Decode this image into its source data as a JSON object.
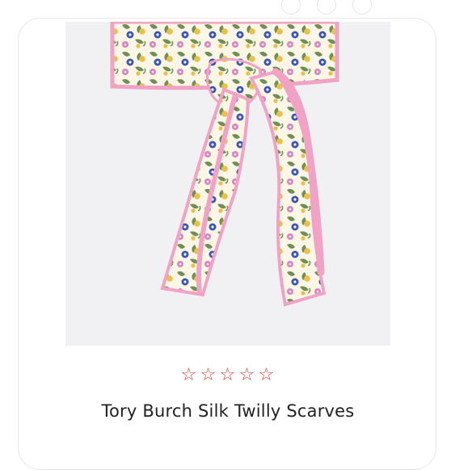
{
  "product": {
    "title": "Tory Burch Silk Twilly Scarves",
    "image_alt": "Floral silk twilly scarf tied in a bow",
    "rating": {
      "stars_filled": 0,
      "stars_total": 5,
      "star_glyph": "☆"
    }
  },
  "colors": {
    "star": "#d33b3b",
    "image_bg": "#f1f0f3",
    "scarf_pink": "#f0a3c4",
    "scarf_cream": "#fbf6e6",
    "leaf_green": "#6f8f57",
    "flower_blue": "#3b55b5",
    "flower_yellow": "#e9c04a",
    "flower_pink": "#d686c5"
  }
}
